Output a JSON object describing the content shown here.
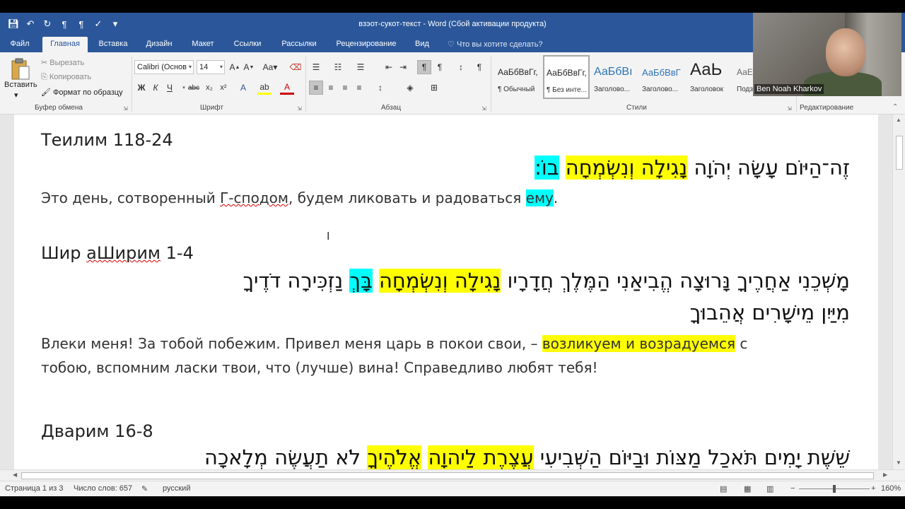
{
  "window": {
    "title": "взэот-сукот-текст - Word (Сбой активации продукта)"
  },
  "qat": {
    "icons": [
      "save-icon",
      "undo-icon",
      "redo-icon",
      "paragraph-rtl-icon",
      "paragraph-ltr-icon",
      "spelling-icon",
      "customize-icon"
    ]
  },
  "tabs": [
    {
      "label": "Файл"
    },
    {
      "label": "Главная"
    },
    {
      "label": "Вставка"
    },
    {
      "label": "Дизайн"
    },
    {
      "label": "Макет"
    },
    {
      "label": "Ссылки"
    },
    {
      "label": "Рассылки"
    },
    {
      "label": "Рецензирование"
    },
    {
      "label": "Вид"
    }
  ],
  "tellme": "Что вы хотите сделать?",
  "clipboard": {
    "paste": "Вставить",
    "cut": "Вырезать",
    "copy": "Копировать",
    "format_painter": "Формат по образцу",
    "group": "Буфер обмена"
  },
  "font": {
    "name": "Calibri (Основ",
    "size": "14",
    "bold": "Ж",
    "italic": "К",
    "underline": "Ч",
    "strike": "abc",
    "group": "Шрифт"
  },
  "paragraph": {
    "group": "Абзац"
  },
  "styles": {
    "items": [
      {
        "sample": "АаБбВвГг,",
        "name": "¶ Обычный"
      },
      {
        "sample": "АаБбВвГг,",
        "name": "¶ Без инте..."
      },
      {
        "sample": "АаБбВı",
        "name": "Заголово..."
      },
      {
        "sample": "АаБбВвГ",
        "name": "Заголово..."
      },
      {
        "sample": "АаЬ",
        "name": "Заголовок"
      },
      {
        "sample": "АаЕ",
        "name": "Подз"
      }
    ],
    "group": "Стили"
  },
  "editing": {
    "group": "Редактирование"
  },
  "video": {
    "name": "Ben Noah Kharkov"
  },
  "document": {
    "s1": {
      "heading": "Теилим 118-24",
      "hebrew_plain": "זֶה־הַיּוֹם עָשָׂה יְהֹוָה ",
      "hebrew_yellow": "נָגִילָה וְנִשְׂמְחָה",
      "hebrew_space": " ",
      "hebrew_cyan": "בוֹ:",
      "russian_a": "Это день, сотворенный ",
      "russian_err": "Г-сподом",
      "russian_b": ", будем ликовать и радоваться ",
      "russian_cyan": "ему",
      "russian_c": "."
    },
    "s2": {
      "heading_a": "Шир ",
      "heading_err": "аШирим",
      "heading_b": " 1-4",
      "hebrew_1a": "מָשְׁכֵנִי אַחֲרֶיךָ נָּרוּצָה הֱבִיאַנִי הַמֶּלֶךְ חֲדָרָיו ",
      "hebrew_1y": "נָגִילָה וְנִשְׂמְחָה",
      "hebrew_1s": " ",
      "hebrew_1c": "בָּךְ",
      "hebrew_1b": " נַזְכִּירָה דֹדֶיךָ",
      "hebrew_2": "מִיַּיִן מֵישָׁרִים אֲהֵבוּךָ",
      "russian_1a": " Влеки меня! За тобой побежим. Привел меня царь в покои свои, – ",
      "russian_1y": "возликуем и возрадуемся",
      "russian_1b": " с",
      "russian_2": "тобою, вспомним ласки твои, что (лучше) вина! Справедливо любят тебя!"
    },
    "s3": {
      "heading": "Дварим 16-8",
      "hebrew_a": "שֵׁשֶׁת יָמִים תֹּאכַל מַצּוֹת וּבַיּוֹם הַשְּׁבִיעִי ",
      "hebrew_y1": "עֲצֶרֶת לַיהוָה",
      "hebrew_s": " ",
      "hebrew_y2": "אֱלֹהֶיךָ",
      "hebrew_b": " לֹא תַעֲשֶׂה מְלָאכָה"
    }
  },
  "status": {
    "page": "Страница 1 из 3",
    "words": "Число слов: 657",
    "language": "русский",
    "zoom": "160%"
  },
  "colors": {
    "title_blue": "#2b579a",
    "highlight_yellow": "#ffff00",
    "highlight_cyan": "#00ffff"
  }
}
